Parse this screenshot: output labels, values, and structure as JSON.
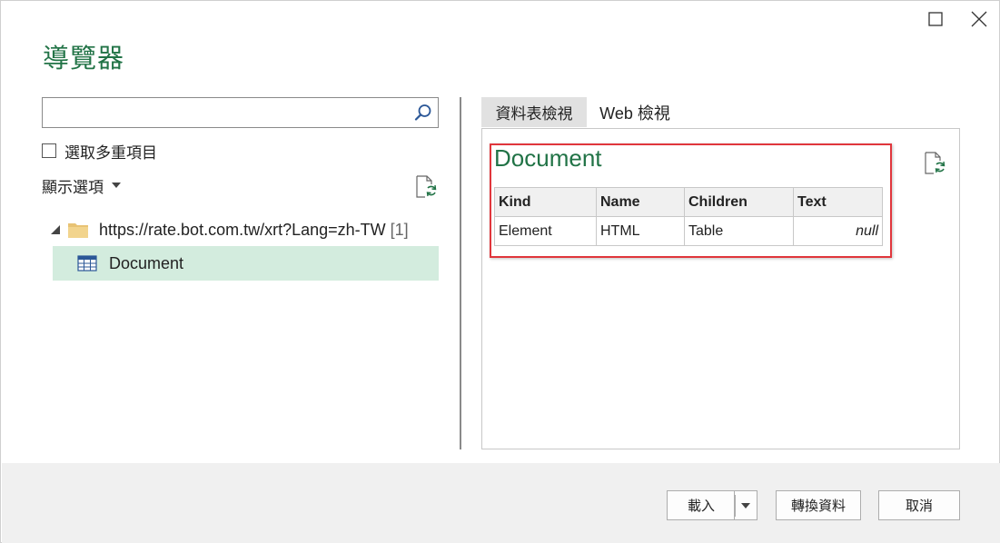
{
  "window": {
    "title": "導覽器",
    "controls": {
      "maximize": "maximize-icon",
      "close": "close-icon"
    }
  },
  "left_panel": {
    "search": {
      "placeholder": "",
      "value": "",
      "icon": "search-icon"
    },
    "multi_select_label": "選取多重項目",
    "display_options_label": "顯示選項",
    "refresh_icon": "refresh-icon",
    "tree": {
      "root": {
        "label": "https://rate.bot.com.tw/xrt?Lang=zh-TW",
        "count": "[1]",
        "icon": "folder-icon"
      },
      "children": [
        {
          "label": "Document",
          "icon": "table-icon",
          "selected": true
        }
      ]
    }
  },
  "right_panel": {
    "tabs": [
      {
        "label": "資料表檢視",
        "active": true
      },
      {
        "label": "Web 檢視",
        "active": false
      }
    ],
    "preview_title": "Document",
    "table": {
      "columns": [
        "Kind",
        "Name",
        "Children",
        "Text"
      ],
      "rows": [
        [
          "Element",
          "HTML",
          "Table",
          "null"
        ]
      ]
    },
    "highlight_color": "#e0363c"
  },
  "footer": {
    "load_label": "載入",
    "transform_label": "轉換資料",
    "cancel_label": "取消"
  },
  "colors": {
    "accent_green": "#217346",
    "selected_row": "#d3ecde",
    "footer_bg": "#f0f0f0"
  }
}
